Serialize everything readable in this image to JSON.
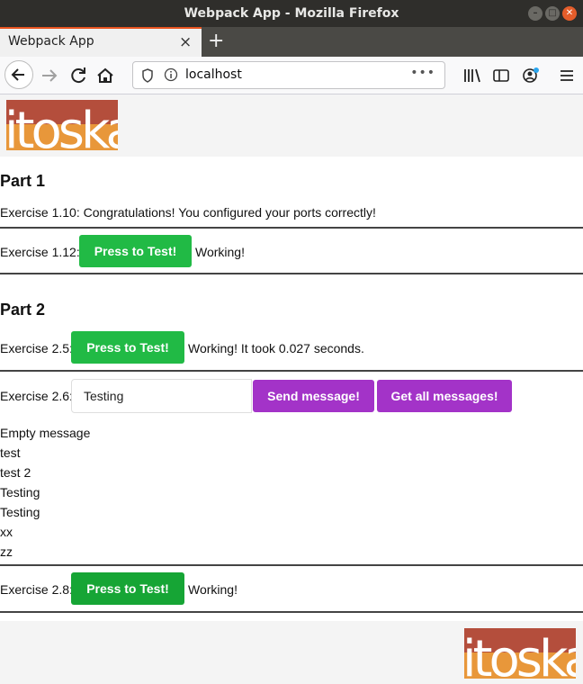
{
  "window": {
    "title": "Webpack App - Mozilla Firefox"
  },
  "tab": {
    "title": "Webpack App",
    "close": "×",
    "new_tab": "+"
  },
  "nav": {
    "url": "localhost",
    "page_actions": "•••"
  },
  "logo": {
    "text": "itoska"
  },
  "part1": {
    "heading": "Part 1",
    "ex110": "Exercise 1.10: Congratulations! You configured your ports correctly!",
    "ex112_label": "Exercise 1.12:",
    "ex112_button": "Press to Test!",
    "ex112_status": "Working!"
  },
  "part2": {
    "heading": "Part 2",
    "ex25_label": "Exercise 2.5:",
    "ex25_button": "Press to Test!",
    "ex25_status": "Working! It took 0.027 seconds.",
    "ex26_label": "Exercise 2.6:",
    "ex26_input_value": "Testing",
    "ex26_send": "Send message!",
    "ex26_get": "Get all messages!",
    "messages": [
      "Empty message",
      "test",
      "test 2",
      "Testing",
      "Testing",
      "xx",
      "zz"
    ],
    "ex28_label": "Exercise 2.8:",
    "ex28_button": "Press to Test!",
    "ex28_status": "Working!"
  },
  "colors": {
    "green": "#21ba45",
    "purple": "#a333c8",
    "logo_red": "#b44e3c",
    "logo_orange": "#e8973a"
  }
}
